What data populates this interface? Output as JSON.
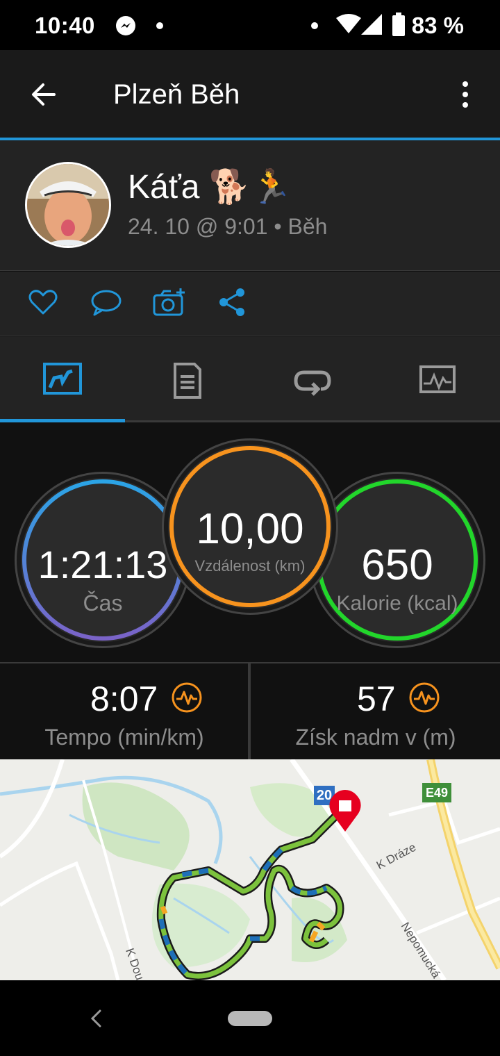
{
  "status_bar": {
    "time": "10:40",
    "battery": "83 %",
    "icons": [
      "messenger-icon",
      "dot-icon",
      "wifi-icon",
      "signal-icon",
      "battery-icon"
    ]
  },
  "app_bar": {
    "title": "Plzeň Běh",
    "back_icon": "back-arrow-icon",
    "menu_icon": "more-vert-icon"
  },
  "activity": {
    "user_name": "Káťa 🐕🏃",
    "meta": "24. 10 @ 9:01 • Běh"
  },
  "actions": [
    "heart-icon",
    "comment-icon",
    "add-photo-icon",
    "share-icon"
  ],
  "tabs": {
    "items": [
      "overview-tab",
      "details-tab",
      "laps-tab",
      "charts-tab"
    ],
    "active_index": 0
  },
  "rings": {
    "time": {
      "value": "1:21:13",
      "label": "Čas"
    },
    "distance": {
      "value": "10,00",
      "label": "Vzdálenost (km)"
    },
    "calories": {
      "value": "650",
      "label": "Kalorie (kcal)"
    }
  },
  "stats": {
    "pace": {
      "value": "8:07",
      "label": "Tempo (min/km)"
    },
    "elevation": {
      "value": "57",
      "label": "Získ nadm v (m)"
    }
  },
  "map": {
    "road_badge_1": "20",
    "road_badge_2": "E49",
    "street_1": "K Dráze",
    "street_2": "Nepomucká",
    "street_3": "K Dou"
  },
  "colors": {
    "accent": "#2196d9",
    "distance_ring": "#f7931e",
    "calories_ring": "#22d62b",
    "stat_icon": "#f7931e",
    "route": "#7cc23d"
  }
}
